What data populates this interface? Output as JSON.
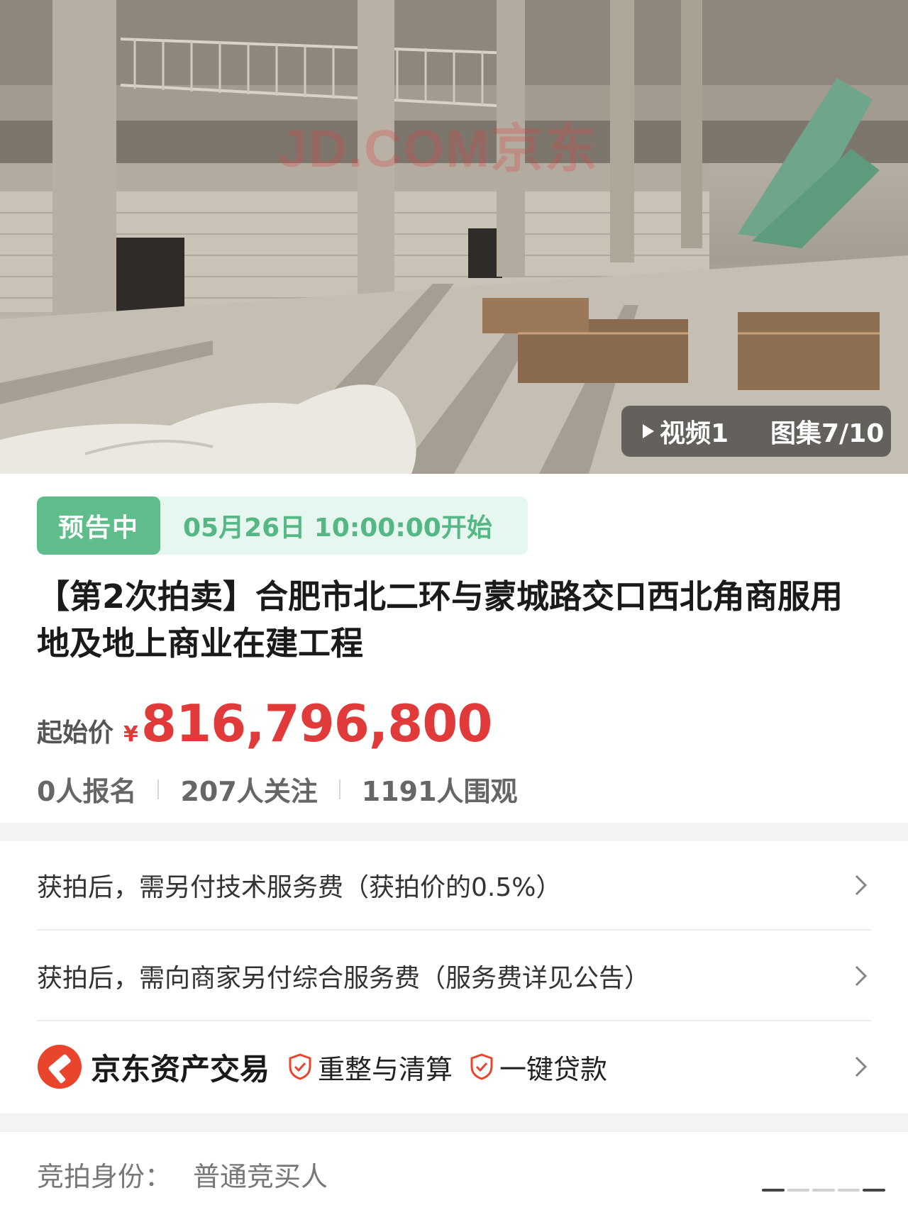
{
  "hero": {
    "watermark": "JD.COM京东",
    "video_label": "视频1",
    "gallery_label": "图集7/10"
  },
  "status": {
    "badge": "预告中",
    "start_time": "05月26日 10:00:00开始",
    "badge_color": "#5fbd8c",
    "time_color": "#55b784"
  },
  "title": "【第2次拍卖】合肥市北二环与蒙城路交口西北角商服用地及地上商业在建工程",
  "price": {
    "label": "起始价",
    "currency": "¥",
    "value": "816,796,800",
    "color": "#e03a3a"
  },
  "stats": {
    "signups": "0人报名",
    "follows": "207人关注",
    "views": "1191人围观"
  },
  "fees": [
    {
      "text": "获拍后，需另付技术服务费（获拍价的0.5%）"
    },
    {
      "text": "获拍后，需向商家另付综合服务费（服务费详见公告）"
    }
  ],
  "brand": {
    "name": "京东资产交易",
    "tags": [
      "重整与清算",
      "一键贷款"
    ],
    "brand_color": "#e8452c"
  },
  "identity": {
    "label": "竞拍身份：",
    "value": "普通竞买人"
  },
  "icons": [
    "play-icon",
    "chevron-right-icon",
    "jd-asset-logo-icon",
    "shield-check-icon"
  ]
}
